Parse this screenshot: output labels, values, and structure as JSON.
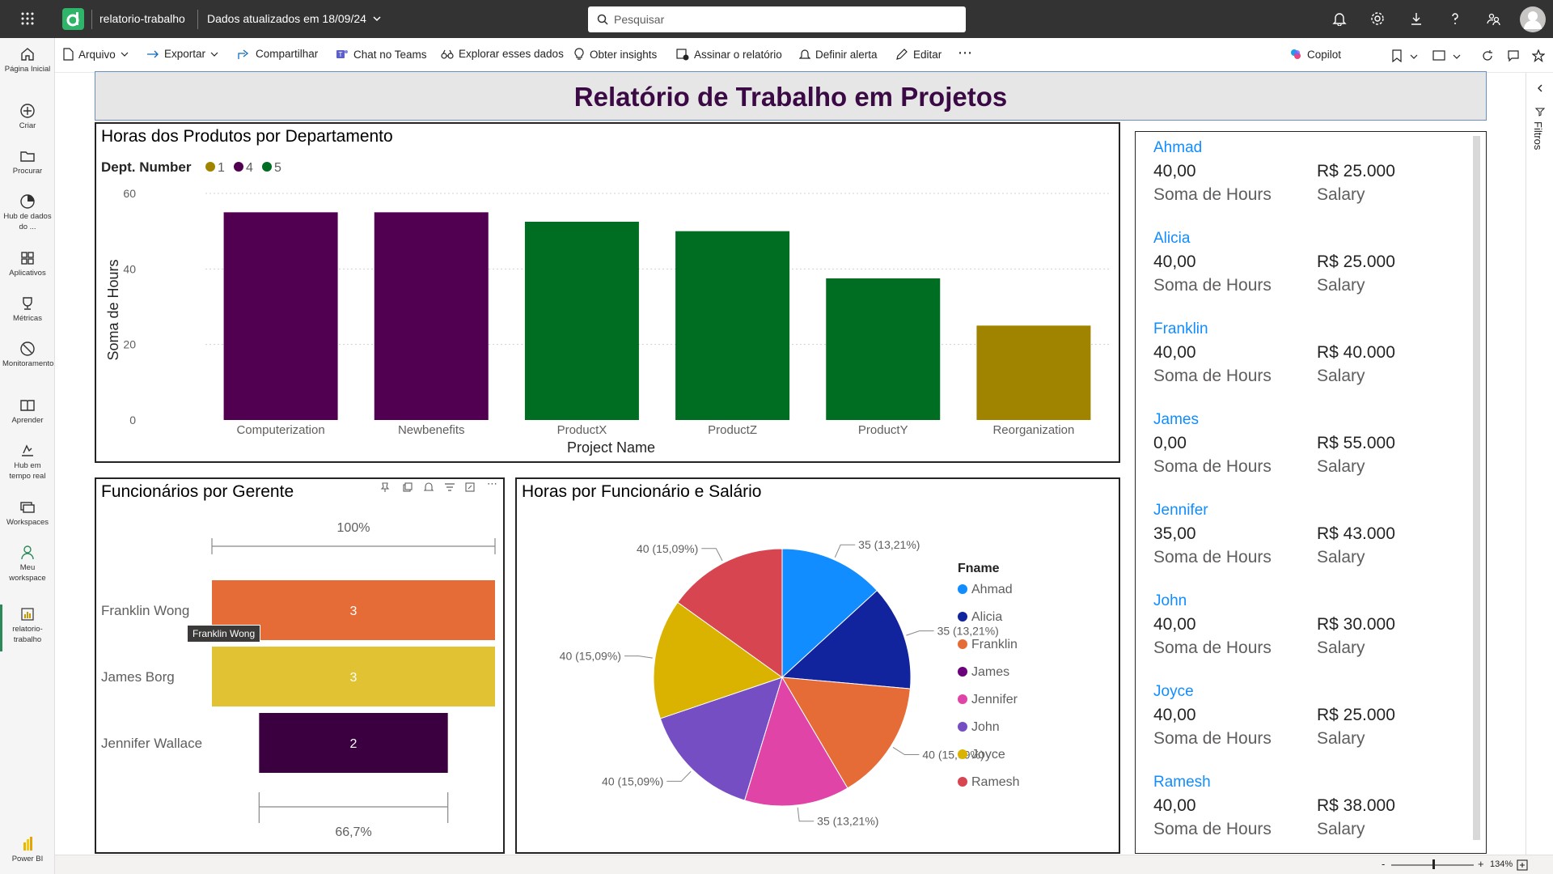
{
  "topbar": {
    "app_name": "relatorio-trabalho",
    "updated": "Dados atualizados em 18/09/24",
    "search_placeholder": "Pesquisar"
  },
  "leftnav": {
    "items": [
      {
        "label": "Página Inicial",
        "icon": "home-icon"
      },
      {
        "label": "Criar",
        "icon": "create-icon"
      },
      {
        "label": "Procurar",
        "icon": "folder-icon"
      },
      {
        "label": "Hub de dados do ...",
        "icon": "data-hub-icon"
      },
      {
        "label": "Aplicativos",
        "icon": "apps-icon"
      },
      {
        "label": "Métricas",
        "icon": "trophy-icon"
      },
      {
        "label": "Monitoramento",
        "icon": "monitor-icon"
      },
      {
        "label": "Aprender",
        "icon": "book-icon"
      },
      {
        "label": "Hub em tempo real",
        "icon": "realtime-icon"
      },
      {
        "label": "Workspaces",
        "icon": "workspaces-icon"
      },
      {
        "label": "Meu workspace",
        "icon": "person-icon"
      },
      {
        "label": "relatorio-trabalho",
        "icon": "report-icon"
      }
    ],
    "bottom_label": "Power BI"
  },
  "cmdbar": {
    "arquivo": "Arquivo",
    "exportar": "Exportar",
    "compartilhar": "Compartilhar",
    "chat": "Chat no Teams",
    "explorar": "Explorar esses dados",
    "insights": "Obter insights",
    "assinar": "Assinar o relatório",
    "alerta": "Definir alerta",
    "editar": "Editar",
    "copilot": "Copilot"
  },
  "rightpane": {
    "filters_label": "Filtros"
  },
  "statusbar": {
    "zoom": "134%"
  },
  "report": {
    "title": "Relatório de Trabalho em Projetos"
  },
  "bar_chart_text": {
    "legend_title": "Dept. Number",
    "legend": [
      {
        "label": "1",
        "color": "#a08400"
      },
      {
        "label": "4",
        "color": "#510051"
      },
      {
        "label": "5",
        "color": "#006e22"
      }
    ]
  },
  "funnel_text": {
    "top_pct": "100%",
    "bottom_pct": "66,7%",
    "tooltip": "Franklin Wong"
  },
  "pie_text": {
    "legend_title": "Fname"
  },
  "chart_data": [
    {
      "type": "bar",
      "title": "Horas dos Produtos por Departamento",
      "xlabel": "Project Name",
      "ylabel": "Soma de Hours",
      "ylim": [
        0,
        60
      ],
      "yticks": [
        0,
        20,
        40,
        60
      ],
      "categories": [
        "Computerization",
        "Newbenefits",
        "ProductX",
        "ProductZ",
        "ProductY",
        "Reorganization"
      ],
      "values": [
        55,
        55,
        52.5,
        50,
        37.5,
        25
      ],
      "dept": [
        "4",
        "4",
        "5",
        "5",
        "5",
        "1"
      ],
      "colors": [
        "#510051",
        "#510051",
        "#006e22",
        "#006e22",
        "#006e22",
        "#a08400"
      ],
      "grid": true,
      "legend_position": "top-left"
    },
    {
      "type": "bar",
      "subtype": "funnel",
      "title": "Funcionários por Gerente",
      "categories": [
        "Franklin Wong",
        "James Borg",
        "Jennifer Wallace"
      ],
      "values": [
        3,
        3,
        2
      ],
      "colors": [
        "#e66c37",
        "#e0c233",
        "#3b0040"
      ]
    },
    {
      "type": "pie",
      "title": "Horas por Funcionário e Salário",
      "legend_title": "Fname",
      "legend_position": "right",
      "labels": [
        "Ahmad",
        "Alicia",
        "Franklin",
        "James",
        "Jennifer",
        "John",
        "Joyce",
        "Ramesh"
      ],
      "values": [
        35,
        35,
        40,
        0,
        35,
        40,
        40,
        40
      ],
      "data_labels": [
        "35 (13,21%)",
        "35 (13,21%)",
        "40 (15,09%)",
        "",
        "35 (13,21%)",
        "40 (15,09%)",
        "40 (15,09%)",
        "40 (15,09%)"
      ],
      "colors": [
        "#118dff",
        "#12239e",
        "#e66c37",
        "#6b007b",
        "#e044a7",
        "#744ec2",
        "#d9b300",
        "#d64550"
      ]
    }
  ],
  "cards": [
    {
      "name": "Ahmad",
      "hours": "40,00",
      "salary": "R$ 25.000"
    },
    {
      "name": "Alicia",
      "hours": "40,00",
      "salary": "R$ 25.000"
    },
    {
      "name": "Franklin",
      "hours": "40,00",
      "salary": "R$ 40.000"
    },
    {
      "name": "James",
      "hours": "0,00",
      "salary": "R$ 55.000"
    },
    {
      "name": "Jennifer",
      "hours": "35,00",
      "salary": "R$ 43.000"
    },
    {
      "name": "John",
      "hours": "40,00",
      "salary": "R$ 30.000"
    },
    {
      "name": "Joyce",
      "hours": "40,00",
      "salary": "R$ 25.000"
    },
    {
      "name": "Ramesh",
      "hours": "40,00",
      "salary": "R$ 38.000"
    }
  ],
  "card_labels": {
    "hours": "Soma de Hours",
    "salary": "Salary"
  }
}
